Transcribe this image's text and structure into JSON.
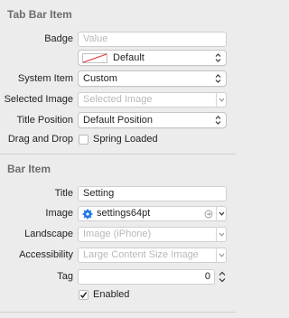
{
  "tab_bar_item": {
    "title": "Tab Bar Item",
    "badge": {
      "label": "Badge",
      "placeholder": "Value"
    },
    "badge_color": {
      "value": "Default"
    },
    "system_item": {
      "label": "System Item",
      "value": "Custom"
    },
    "selected_image": {
      "label": "Selected Image",
      "placeholder": "Selected Image"
    },
    "title_position": {
      "label": "Title Position",
      "value": "Default Position"
    },
    "drag_and_drop": {
      "label": "Drag and Drop",
      "checkbox_label": "Spring Loaded",
      "checked": false
    }
  },
  "bar_item": {
    "title": "Bar Item",
    "item_title": {
      "label": "Title",
      "value": "Setting"
    },
    "image": {
      "label": "Image",
      "value": "settings64pt",
      "icon": "gear-icon"
    },
    "landscape": {
      "label": "Landscape",
      "placeholder": "Image (iPhone)"
    },
    "accessibility": {
      "label": "Accessibility",
      "placeholder": "Large Content Size Image"
    },
    "tag": {
      "label": "Tag",
      "value": "0"
    },
    "enabled": {
      "checkbox_label": "Enabled",
      "checked": true
    }
  },
  "colors": {
    "accent": "#1a73e8",
    "swatch_line": "#e03030"
  }
}
